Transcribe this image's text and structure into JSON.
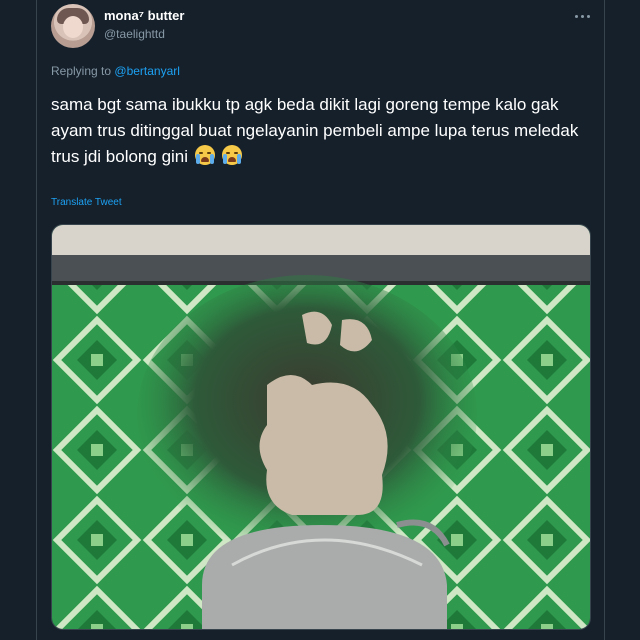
{
  "author": {
    "name": "mona⁷ butter",
    "handle": "@taelighttd"
  },
  "reply": {
    "prefix": "Replying to",
    "mention": "@bertanyarl"
  },
  "tweet": {
    "text": "sama bgt sama ibukku tp agk beda dikit lagi goreng tempe kalo gak ayam trus ditinggal buat ngelayanin pembeli ampe lupa terus meledak trus jdi bolong gini",
    "emoji": "crying-face-icon",
    "translate_label": "Translate Tweet"
  },
  "colors": {
    "background": "#15202b",
    "accent": "#1da1f2",
    "muted": "#8899a6"
  }
}
